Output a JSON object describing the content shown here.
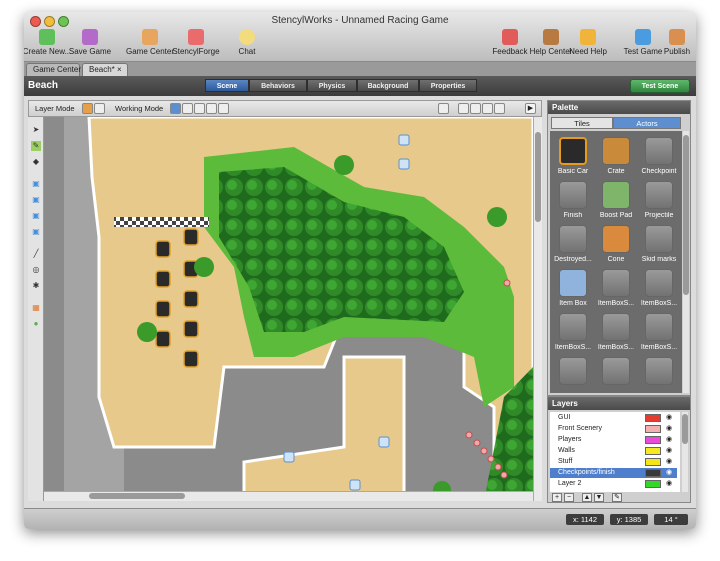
{
  "window": {
    "title": "StencylWorks - Unnamed Racing Game"
  },
  "toolbar": {
    "create_new": "Create New...",
    "save_game": "Save Game",
    "game_center": "Game Center",
    "stencylforge": "StencylForge",
    "chat": "Chat",
    "feedback": "Feedback",
    "help_center": "Help Center",
    "need_help": "Need Help",
    "test_game": "Test Game",
    "publish": "Publish"
  },
  "doc_tabs": {
    "game_center": "Game Center",
    "beach": "Beach*",
    "close": "×"
  },
  "scene": {
    "name": "Beach",
    "tabs": [
      "Scene",
      "Behaviors",
      "Physics",
      "Background",
      "Properties"
    ],
    "test_scene": "Test Scene"
  },
  "mode_bar": {
    "layer_mode": "Layer Mode",
    "working_mode": "Working Mode"
  },
  "palette": {
    "title": "Palette",
    "tabs": {
      "tiles": "Tiles",
      "actors": "Actors"
    },
    "actors": [
      "Basic Car",
      "Crate",
      "Checkpoint",
      "Finish",
      "Boost Pad",
      "Projectile",
      "Destroyed...",
      "Cone",
      "Skid marks",
      "Item Box",
      "ItemBoxS...",
      "ItemBoxS...",
      "ItemBoxS...",
      "ItemBoxS...",
      "ItemBoxS..."
    ]
  },
  "layers": {
    "title": "Layers",
    "items": [
      {
        "name": "GUI",
        "color": "#e83a2e"
      },
      {
        "name": "Front Scenery",
        "color": "#f2b0b0"
      },
      {
        "name": "Players",
        "color": "#e84ad9"
      },
      {
        "name": "Walls",
        "color": "#f5ea22"
      },
      {
        "name": "Stuff",
        "color": "#f5e61a"
      },
      {
        "name": "Checkpoints/finish",
        "color": "#3a3a3a"
      },
      {
        "name": "Layer 2",
        "color": "#35d62a"
      }
    ],
    "selected": "Checkpoints/finish"
  },
  "status": {
    "x": "x: 1142",
    "y": "y: 1385",
    "zoom": "14 °"
  }
}
